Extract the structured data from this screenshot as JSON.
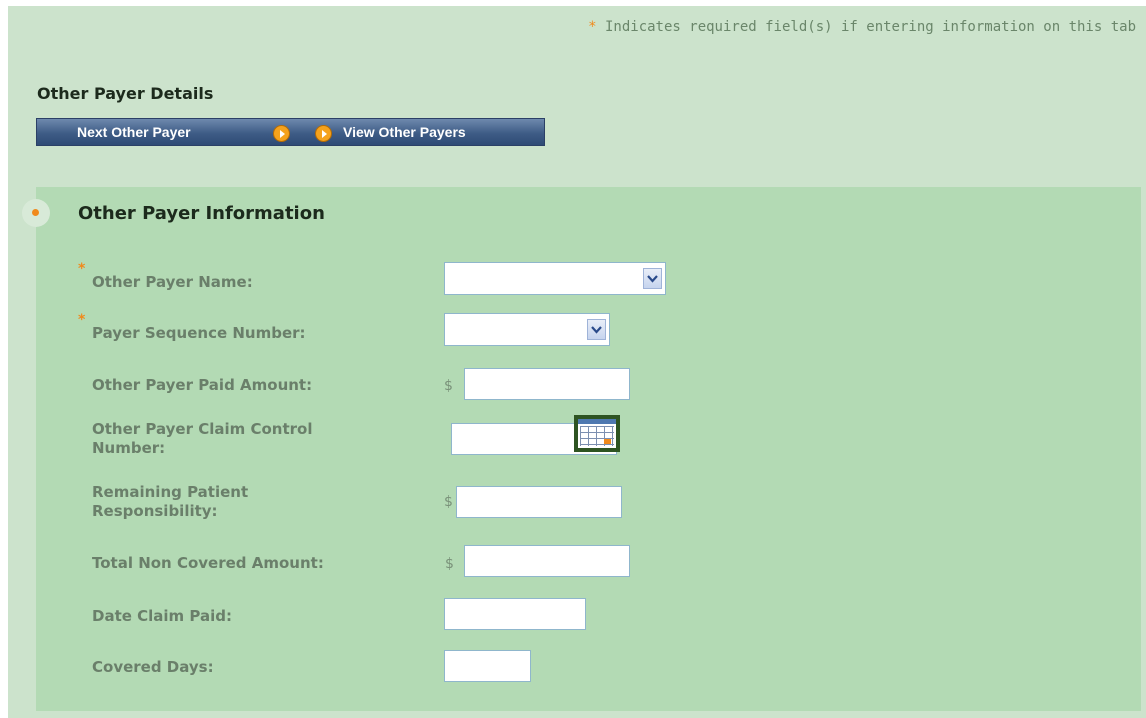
{
  "required_note": {
    "star": "*",
    "text": "Indicates required field(s) if entering information on this tab"
  },
  "details": {
    "title": "Other Payer Details",
    "next_label": "Next Other Payer",
    "view_label": "View Other Payers"
  },
  "panel": {
    "title": "Other Payer Information"
  },
  "fields": {
    "payer_name": {
      "star": "*",
      "label": "Other Payer Name:",
      "value": ""
    },
    "sequence_number": {
      "star": "*",
      "label": "Payer Sequence Number:",
      "value": ""
    },
    "paid_amount": {
      "label": "Other Payer Paid Amount:",
      "currency": "$",
      "value": ""
    },
    "claim_control": {
      "label_line1": "Other Payer Claim Control",
      "label_line2": "Number:",
      "value": ""
    },
    "remaining_resp": {
      "label_line1": "Remaining Patient",
      "label_line2": "Responsibility:",
      "currency": "$",
      "value": ""
    },
    "non_covered": {
      "label": "Total Non Covered Amount:",
      "currency": "$",
      "value": ""
    },
    "date_paid": {
      "label": "Date Claim Paid:",
      "value": ""
    },
    "covered_days": {
      "label": "Covered Days:",
      "value": ""
    }
  },
  "icons": {
    "calendar": "calendar-icon",
    "dropdown": "chevron-down-icon",
    "arrow": "arrow-right-circle-icon"
  },
  "colors": {
    "background": "#cce3cc",
    "panel": "#b3dab4",
    "accent": "#f08a1c",
    "nav_bar": "#3e5c86",
    "label": "#6a7f6a"
  }
}
